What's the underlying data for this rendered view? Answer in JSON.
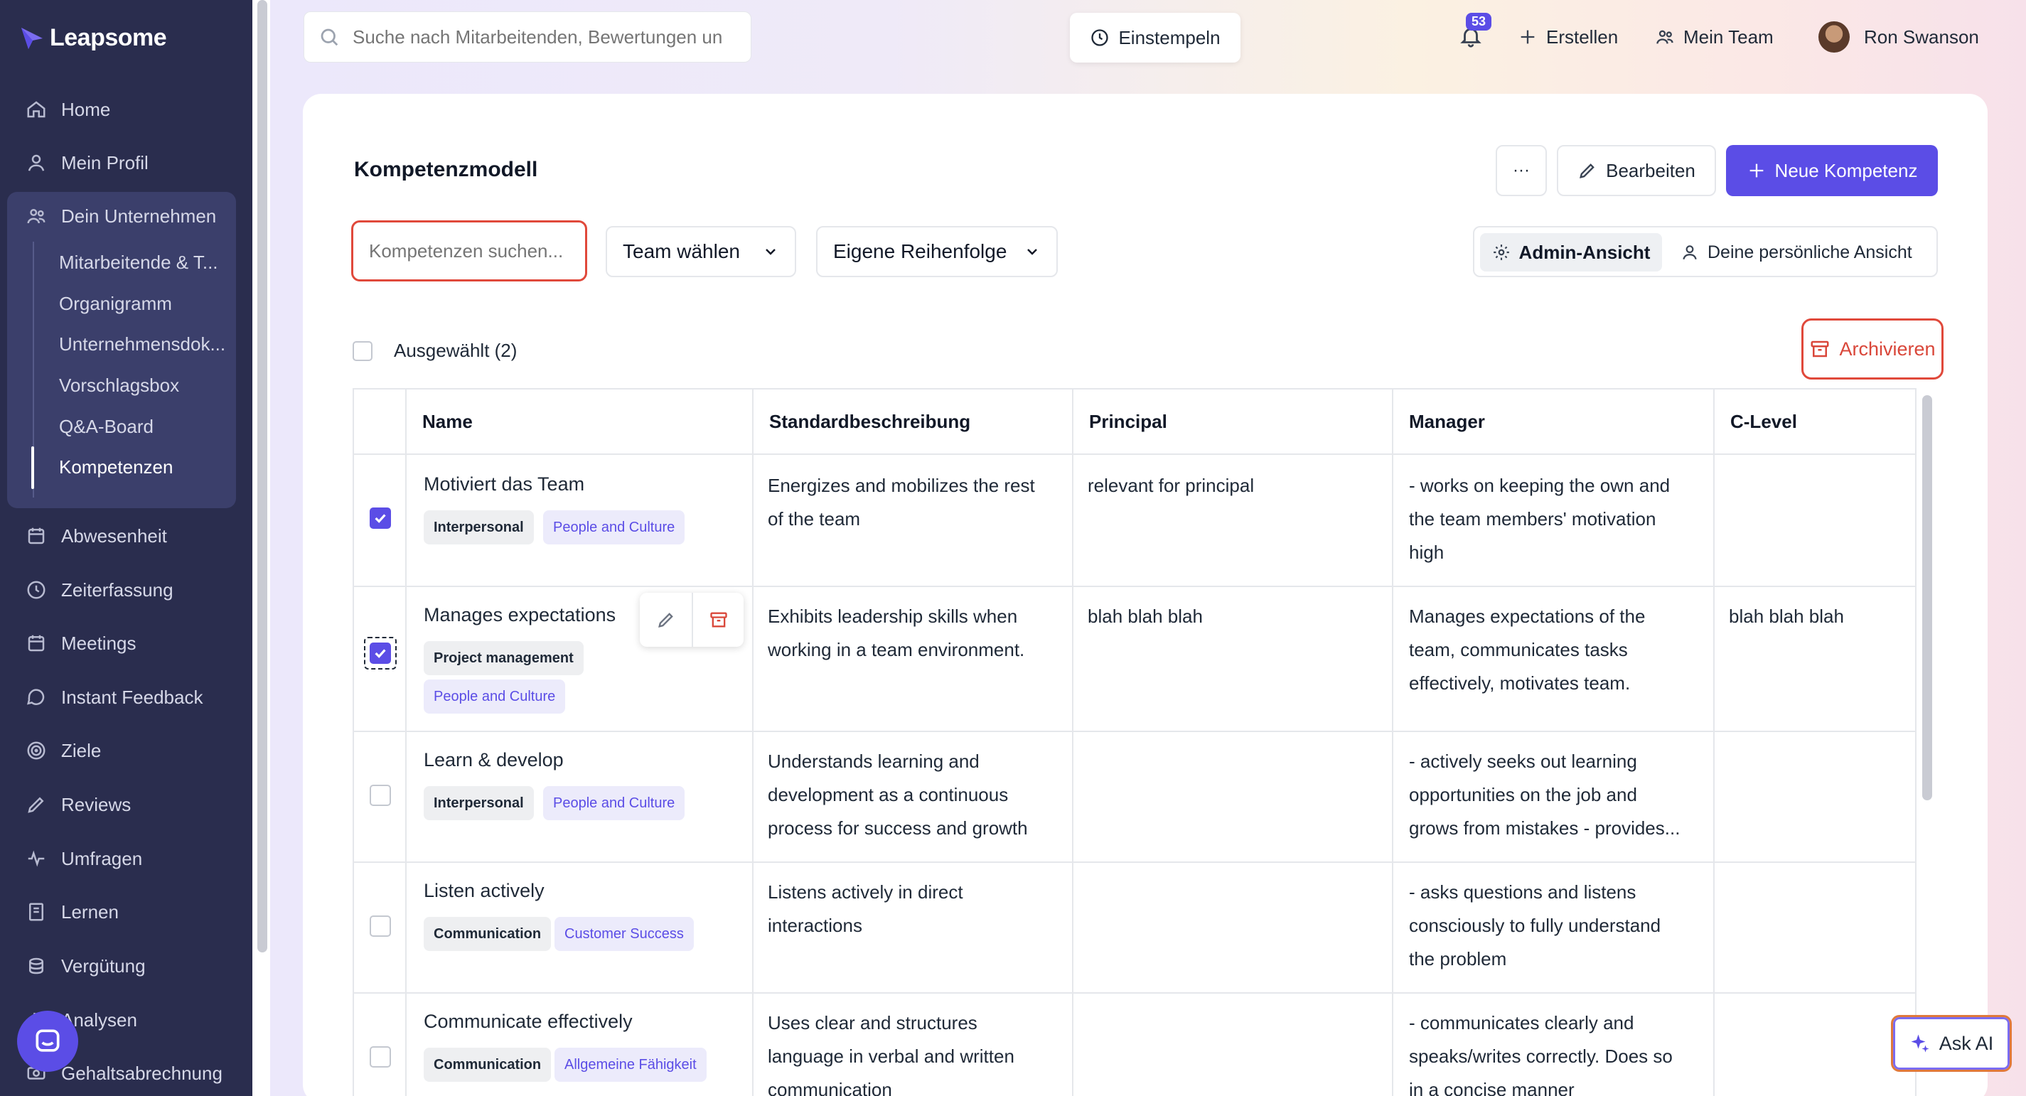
{
  "app": {
    "name": "Leapsome"
  },
  "sidebar": {
    "items": [
      {
        "label": "Home",
        "icon": "home-icon"
      },
      {
        "label": "Mein Profil",
        "icon": "user-icon"
      },
      {
        "label": "Dein Unternehmen",
        "icon": "users-icon"
      },
      {
        "label": "Abwesenheit",
        "icon": "calendar-icon"
      },
      {
        "label": "Zeiterfassung",
        "icon": "clock-icon"
      },
      {
        "label": "Meetings",
        "icon": "calendar-icon"
      },
      {
        "label": "Instant Feedback",
        "icon": "chat-icon"
      },
      {
        "label": "Ziele",
        "icon": "target-icon"
      },
      {
        "label": "Reviews",
        "icon": "pen-icon"
      },
      {
        "label": "Umfragen",
        "icon": "pulse-icon"
      },
      {
        "label": "Lernen",
        "icon": "book-icon"
      },
      {
        "label": "Vergütung",
        "icon": "coins-icon"
      },
      {
        "label": "Analysen",
        "icon": "chart-icon"
      },
      {
        "label": "Gehaltsabrechnung",
        "icon": "money-icon"
      }
    ],
    "sub_items": [
      {
        "label": "Mitarbeitende & T..."
      },
      {
        "label": "Organigramm"
      },
      {
        "label": "Unternehmensdok..."
      },
      {
        "label": "Vorschlagsbox"
      },
      {
        "label": "Q&A-Board"
      },
      {
        "label": "Kompetenzen"
      }
    ]
  },
  "topbar": {
    "search_placeholder": "Suche nach Mitarbeitenden, Bewertungen un",
    "clock_in": "Einstempeln",
    "notifications_count": "53",
    "create": "Erstellen",
    "my_team": "Mein Team",
    "user_name": "Ron Swanson"
  },
  "page": {
    "title": "Kompetenzmodell",
    "more_label": "···",
    "edit_label": "Bearbeiten",
    "new_label": "Neue Kompetenz",
    "filter_placeholder": "Kompetenzen suchen...",
    "team_select": "Team wählen",
    "order_select": "Eigene Reihenfolge",
    "admin_view": "Admin-Ansicht",
    "personal_view": "Deine persönliche Ansicht",
    "selected_label": "Ausgewählt (2)",
    "archive_label": "Archivieren"
  },
  "table": {
    "headers": [
      "Name",
      "Standardbeschreibung",
      "Principal",
      "Manager",
      "C-Level"
    ],
    "rows": [
      {
        "name": "Motiviert das Team",
        "tags": [
          "Interpersonal",
          "People and Culture"
        ],
        "checked": true,
        "description": [
          "Energizes and mobilizes the rest",
          "of the team"
        ],
        "principal": [
          "relevant for principal"
        ],
        "manager": [
          "- works on keeping the own and",
          "the team members' motivation",
          "high"
        ],
        "clevel": []
      },
      {
        "name": "Manages expectations",
        "tags": [
          "Project management",
          "People and Culture"
        ],
        "checked": true,
        "description": [
          "Exhibits leadership skills when",
          "working in a team environment."
        ],
        "principal": [
          "blah blah blah"
        ],
        "manager": [
          "Manages expectations of the",
          "team, communicates tasks",
          "effectively, motivates team."
        ],
        "clevel": [
          "blah blah blah"
        ]
      },
      {
        "name": "Learn & develop",
        "tags": [
          "Interpersonal",
          "People and Culture"
        ],
        "checked": false,
        "description": [
          "Understands learning and",
          "development as a continuous",
          "process for success and growth"
        ],
        "principal": [],
        "manager": [
          "- actively seeks out learning",
          "opportunities on the job and",
          "grows from mistakes - provides..."
        ],
        "clevel": []
      },
      {
        "name": "Listen actively",
        "tags": [
          "Communication",
          "Customer Success"
        ],
        "checked": false,
        "description": [
          "Listens actively in direct",
          "interactions"
        ],
        "principal": [],
        "manager": [
          "- asks questions and listens",
          "consciously to fully understand",
          "the problem"
        ],
        "clevel": []
      },
      {
        "name": "Communicate effectively",
        "tags": [
          "Communication",
          "Allgemeine Fähigkeit"
        ],
        "checked": false,
        "description": [
          "Uses clear and structures",
          "language in verbal and written",
          "communication"
        ],
        "principal": [],
        "manager": [
          "- communicates clearly and",
          "speaks/writes correctly. Does so",
          "in a concise manner"
        ],
        "clevel": []
      }
    ]
  },
  "ask_ai": {
    "label": "Ask AI"
  },
  "colors": {
    "sidebar": "#2a2d4e",
    "accent": "#5b4de6",
    "highlight": "#e0493b"
  }
}
